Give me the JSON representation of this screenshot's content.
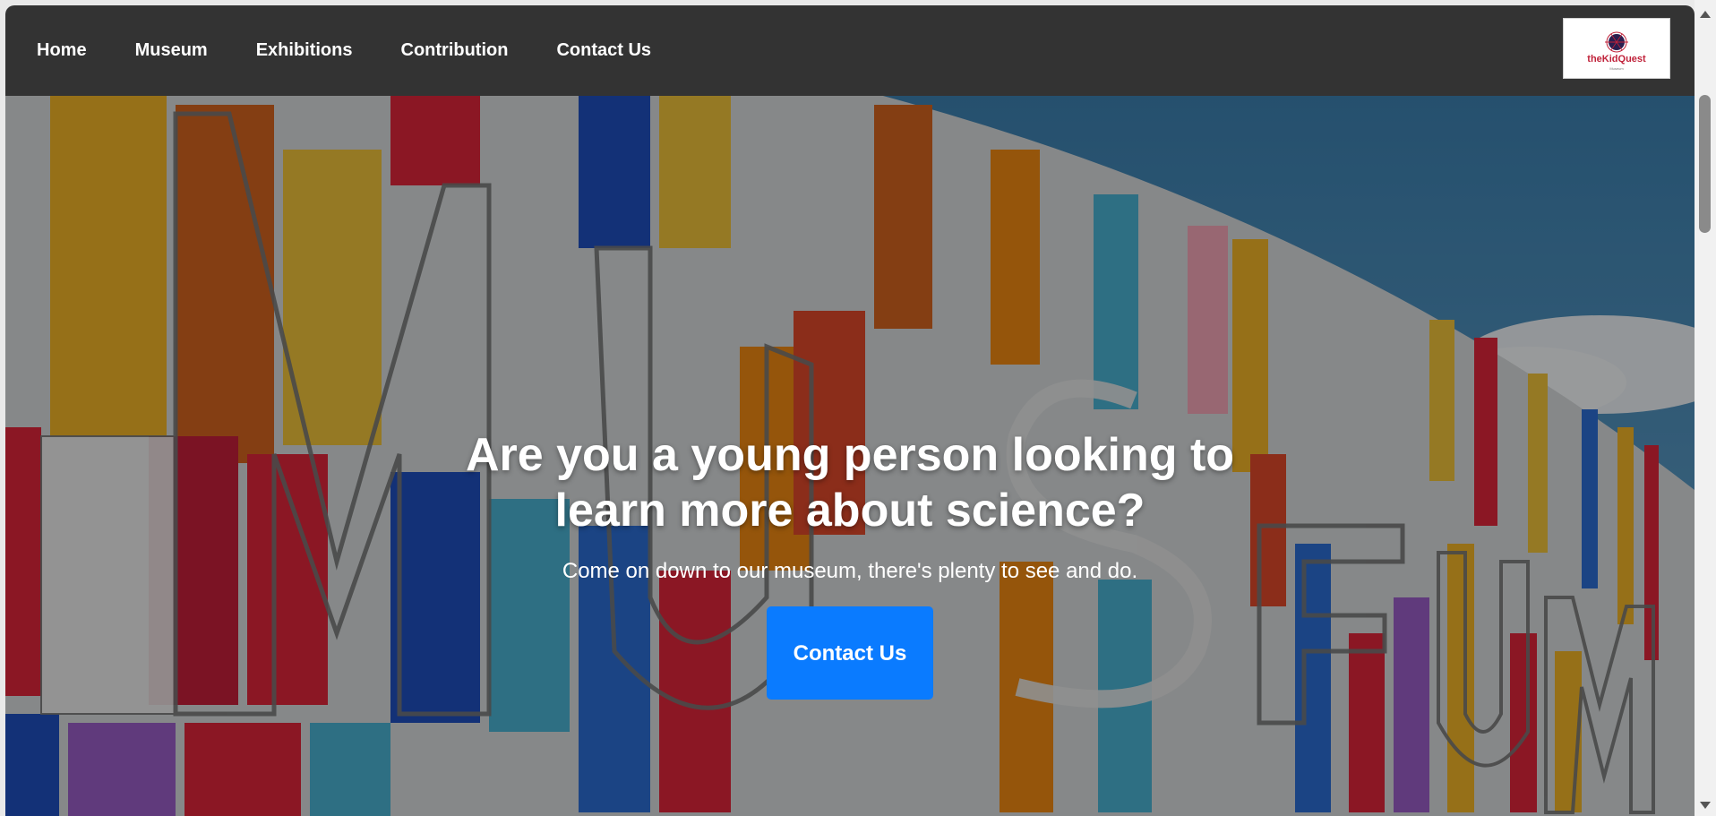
{
  "nav": {
    "items": [
      {
        "label": "Home"
      },
      {
        "label": "Museum"
      },
      {
        "label": "Exhibitions"
      },
      {
        "label": "Contribution"
      },
      {
        "label": "Contact Us"
      }
    ],
    "logo": {
      "text": "theKidQuest",
      "subtext": "Museum",
      "icon": "planet-icon"
    }
  },
  "hero": {
    "title": "Are you a young person looking to learn more about science?",
    "subtitle": "Come on down to our museum, there's plenty to see and do.",
    "button_label": "Contact Us",
    "background": "colorful-museum-facade-image"
  },
  "colors": {
    "nav_bg": "#333333",
    "accent": "#0a7bff",
    "text": "#ffffff"
  }
}
